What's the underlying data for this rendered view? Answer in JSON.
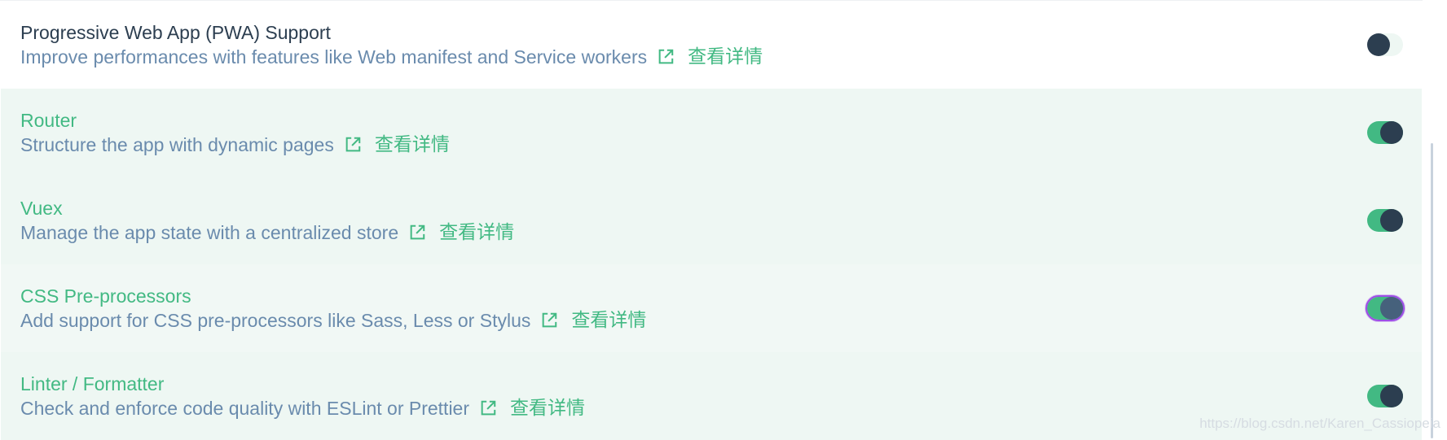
{
  "features": [
    {
      "name": "Progressive Web App (PWA) Support",
      "description": "Improve performances with features like Web manifest and Service workers",
      "details_label": "查看详情",
      "enabled": false,
      "state": "unselected"
    },
    {
      "name": "Router",
      "description": "Structure the app with dynamic pages",
      "details_label": "查看详情",
      "enabled": true,
      "state": "selected"
    },
    {
      "name": "Vuex",
      "description": "Manage the app state with a centralized store",
      "details_label": "查看详情",
      "enabled": true,
      "state": "selected"
    },
    {
      "name": "CSS Pre-processors",
      "description": "Add support for CSS pre-processors like Sass, Less or Stylus",
      "details_label": "查看详情",
      "enabled": true,
      "state": "focused"
    },
    {
      "name": "Linter / Formatter",
      "description": "Check and enforce code quality with ESLint or Prettier",
      "details_label": "查看详情",
      "enabled": true,
      "state": "selected"
    }
  ],
  "icons": {
    "external_link": "external-link-icon"
  },
  "colors": {
    "accent": "#42b983",
    "text_dark": "#2c3e50",
    "text_muted": "#6a8bad",
    "selected_background": "#eef7f3",
    "focus_outline": "#9d4ee6"
  },
  "watermark": "https://blog.csdn.net/Karen_Cassiopeia"
}
